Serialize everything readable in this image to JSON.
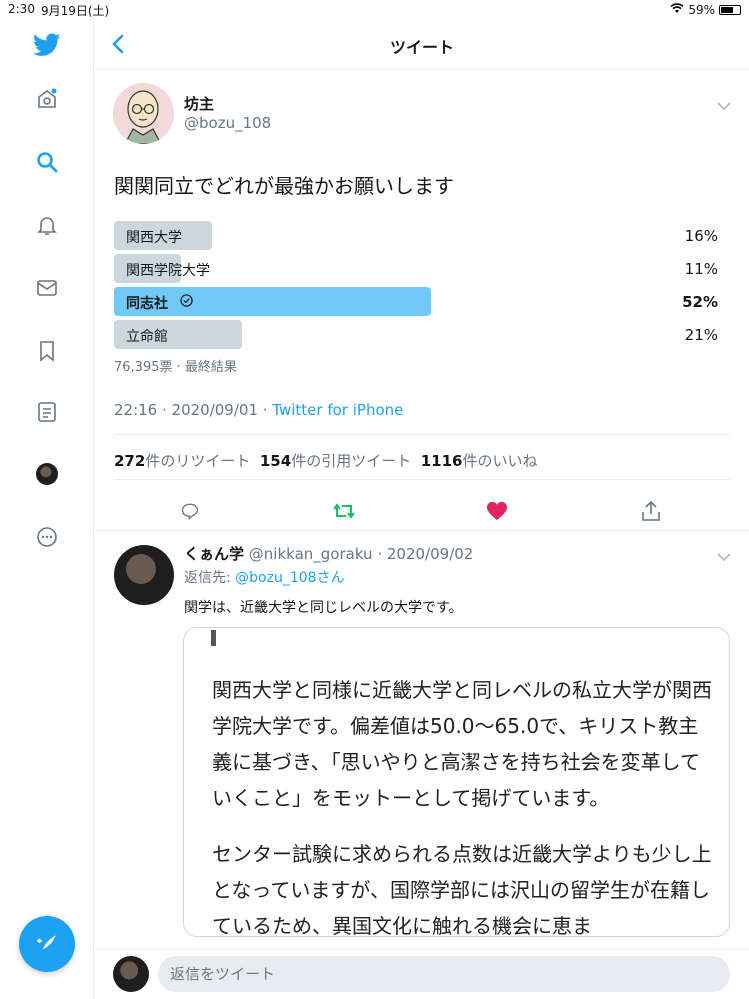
{
  "status": {
    "time": "2:30",
    "date": "9月19日(土)",
    "battery": "59%"
  },
  "header": {
    "title": "ツイート"
  },
  "tweet": {
    "author_name": "坊主",
    "author_handle": "@bozu_108",
    "text": "関関同立でどれが最強かお願いします",
    "poll": {
      "options": [
        {
          "label": "関西大学",
          "percent": 16,
          "percent_text": "16%",
          "winner": false
        },
        {
          "label": "関西学院大学",
          "percent": 11,
          "percent_text": "11%",
          "winner": false
        },
        {
          "label": "同志社",
          "percent": 52,
          "percent_text": "52%",
          "winner": true
        },
        {
          "label": "立命館",
          "percent": 21,
          "percent_text": "21%",
          "winner": false
        }
      ],
      "meta": "76,395票 · 最終結果"
    },
    "timestamp": "22:16 · 2020/09/01 · ",
    "source": "Twitter for iPhone",
    "stats": {
      "retweets": "272",
      "retweets_label": "件のリツイート",
      "quotes": "154",
      "quotes_label": "件の引用ツイート",
      "likes": "1116",
      "likes_label": "件のいいね"
    }
  },
  "reply": {
    "name": "くぁん学",
    "handle_date": "@nikkan_goraku · 2020/09/02",
    "reply_to_prefix": "返信先: ",
    "reply_to_handle": "@bozu_108さん",
    "text": "関学は、近畿大学と同じレベルの大学です。",
    "card": {
      "p1": "関西大学と同様に近畿大学と同レベルの私立大学が関西学院大学です。偏差値は50.0〜65.0で、キリスト教主義に基づき、「思いやりと高潔さを持ち社会を変革していくこと」をモットーとして掲げています。",
      "p2": "センター試験に求められる点数は近畿大学よりも少し上となっていますが、国際学部には沢山の留学生が在籍しているため、異国文化に触れる機会に恵ま"
    }
  },
  "compose": {
    "placeholder": "返信をツイート"
  },
  "colors": {
    "accent": "#1da1f2",
    "retweet": "#17bf63",
    "like": "#e0245e",
    "poll_win": "#71c9f8",
    "poll_bar": "#ccd6dd"
  }
}
